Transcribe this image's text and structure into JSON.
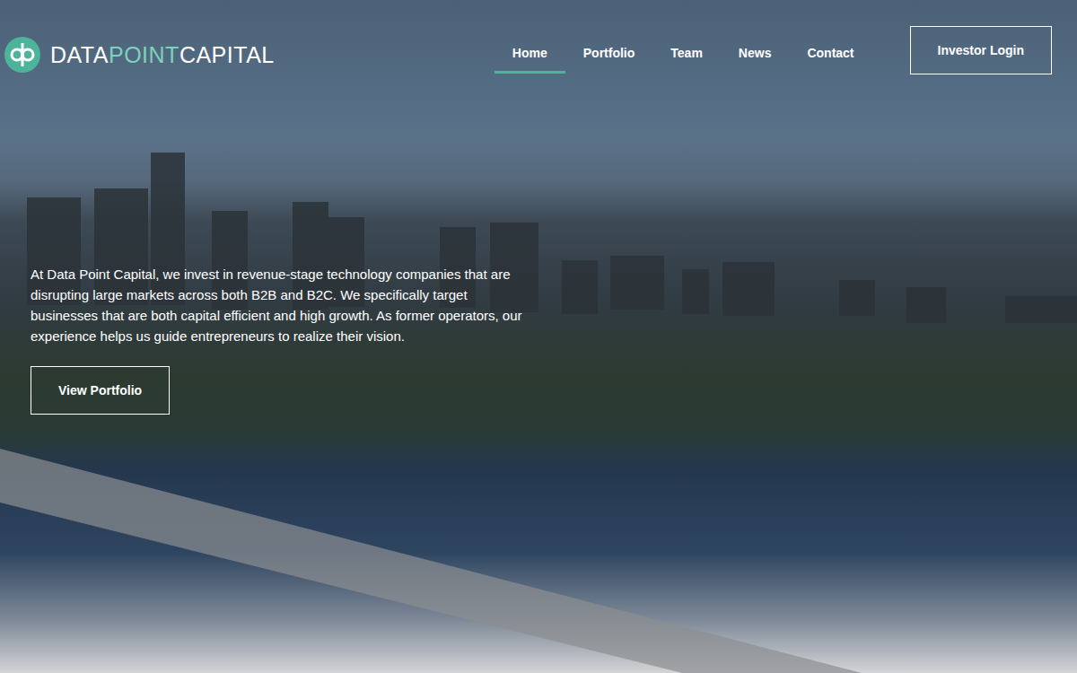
{
  "brand": {
    "parts": [
      {
        "text": "DATA",
        "color": "#ffffff"
      },
      {
        "text": "POINT",
        "color": "#7fd0bd"
      },
      {
        "text": "CAPITAL",
        "color": "#ffffff"
      }
    ]
  },
  "nav": [
    {
      "label": "Home",
      "selected": true
    },
    {
      "label": "Portfolio",
      "selected": false
    },
    {
      "label": "Team",
      "selected": false
    },
    {
      "label": "News",
      "selected": false
    },
    {
      "label": "Contact",
      "selected": false
    }
  ],
  "investor_login": "Investor Login",
  "hero": {
    "text": "At Data Point Capital, we invest in revenue-stage technology companies that are disrupting large markets across both B2B and B2C. We specifically target businesses that are both capital efficient and high growth. As former operators, our experience helps us guide entrepreneurs to realize their vision.",
    "button": "View Portfolio"
  }
}
